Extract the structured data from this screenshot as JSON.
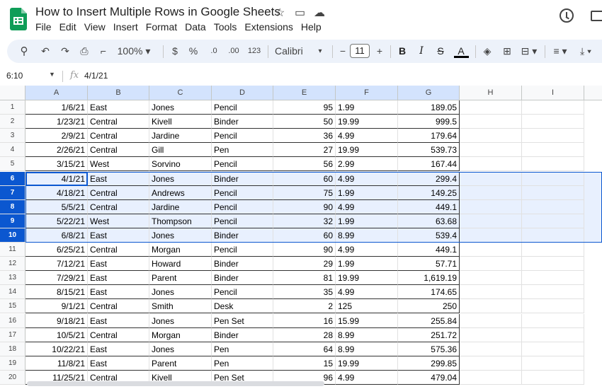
{
  "title": "How to Insert Multiple Rows in Google Sheets",
  "menu": [
    "File",
    "Edit",
    "View",
    "Insert",
    "Format",
    "Data",
    "Tools",
    "Extensions",
    "Help"
  ],
  "toolbar": {
    "zoom": "100%",
    "currency": "$",
    "percent": "%",
    "dec_decrease": ".0",
    "dec_increase": ".00",
    "format_number": "123",
    "font": "Calibri",
    "font_size": "11",
    "minus": "−",
    "plus": "+",
    "bold": "B",
    "italic": "I",
    "strike": "S",
    "text_color": "A"
  },
  "formula_bar": {
    "name_box": "6:10",
    "fx": "fx",
    "value": "4/1/21"
  },
  "columns": [
    "A",
    "B",
    "C",
    "D",
    "E",
    "F",
    "G",
    "H",
    "I"
  ],
  "rows": [
    {
      "n": "1",
      "cells": [
        "1/6/21",
        "East",
        "Jones",
        "Pencil",
        "95",
        "1.99",
        "189.05"
      ]
    },
    {
      "n": "2",
      "cells": [
        "1/23/21",
        "Central",
        "Kivell",
        "Binder",
        "50",
        "19.99",
        "999.5"
      ]
    },
    {
      "n": "3",
      "cells": [
        "2/9/21",
        "Central",
        "Jardine",
        "Pencil",
        "36",
        "4.99",
        "179.64"
      ]
    },
    {
      "n": "4",
      "cells": [
        "2/26/21",
        "Central",
        "Gill",
        "Pen",
        "27",
        "19.99",
        "539.73"
      ]
    },
    {
      "n": "5",
      "cells": [
        "3/15/21",
        "West",
        "Sorvino",
        "Pencil",
        "56",
        "2.99",
        "167.44"
      ]
    },
    {
      "n": "6",
      "cells": [
        "4/1/21",
        "East",
        "Jones",
        "Binder",
        "60",
        "4.99",
        "299.4"
      ],
      "sel": true
    },
    {
      "n": "7",
      "cells": [
        "4/18/21",
        "Central",
        "Andrews",
        "Pencil",
        "75",
        "1.99",
        "149.25"
      ],
      "sel": true
    },
    {
      "n": "8",
      "cells": [
        "5/5/21",
        "Central",
        "Jardine",
        "Pencil",
        "90",
        "4.99",
        "449.1"
      ],
      "sel": true
    },
    {
      "n": "9",
      "cells": [
        "5/22/21",
        "West",
        "Thompson",
        "Pencil",
        "32",
        "1.99",
        "63.68"
      ],
      "sel": true
    },
    {
      "n": "10",
      "cells": [
        "6/8/21",
        "East",
        "Jones",
        "Binder",
        "60",
        "8.99",
        "539.4"
      ],
      "sel": true
    },
    {
      "n": "11",
      "cells": [
        "6/25/21",
        "Central",
        "Morgan",
        "Pencil",
        "90",
        "4.99",
        "449.1"
      ]
    },
    {
      "n": "12",
      "cells": [
        "7/12/21",
        "East",
        "Howard",
        "Binder",
        "29",
        "1.99",
        "57.71"
      ]
    },
    {
      "n": "13",
      "cells": [
        "7/29/21",
        "East",
        "Parent",
        "Binder",
        "81",
        "19.99",
        "1,619.19"
      ]
    },
    {
      "n": "14",
      "cells": [
        "8/15/21",
        "East",
        "Jones",
        "Pencil",
        "35",
        "4.99",
        "174.65"
      ]
    },
    {
      "n": "15",
      "cells": [
        "9/1/21",
        "Central",
        "Smith",
        "Desk",
        "2",
        "125",
        "250"
      ]
    },
    {
      "n": "16",
      "cells": [
        "9/18/21",
        "East",
        "Jones",
        "Pen Set",
        "16",
        "15.99",
        "255.84"
      ]
    },
    {
      "n": "17",
      "cells": [
        "10/5/21",
        "Central",
        "Morgan",
        "Binder",
        "28",
        "8.99",
        "251.72"
      ]
    },
    {
      "n": "18",
      "cells": [
        "10/22/21",
        "East",
        "Jones",
        "Pen",
        "64",
        "8.99",
        "575.36"
      ]
    },
    {
      "n": "19",
      "cells": [
        "11/8/21",
        "East",
        "Parent",
        "Pen",
        "15",
        "19.99",
        "299.85"
      ]
    },
    {
      "n": "20",
      "cells": [
        "11/25/21",
        "Central",
        "Kivell",
        "Pen Set",
        "96",
        "4.99",
        "479.04"
      ]
    }
  ]
}
